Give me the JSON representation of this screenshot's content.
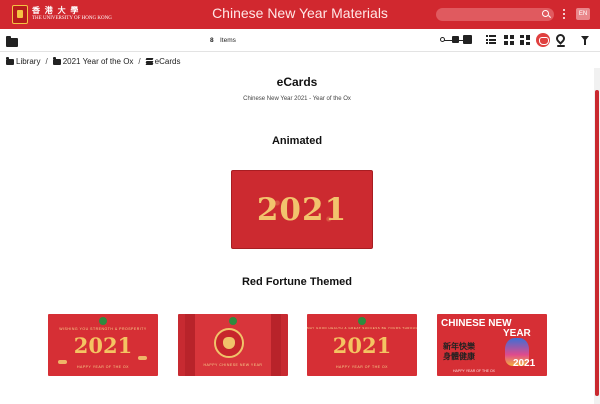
{
  "header": {
    "university_cn": "香 港 大 學",
    "university_en": "THE UNIVERSITY OF HONG KONG",
    "title": "Chinese New Year Materials",
    "search_placeholder": "",
    "language": "EN"
  },
  "toolbar": {
    "item_count": "8",
    "item_label": "Items"
  },
  "breadcrumb": [
    {
      "label": "Library",
      "icon": "folder-icon"
    },
    {
      "label": "2021 Year of the Ox",
      "icon": "folder-icon"
    },
    {
      "label": "eCards",
      "icon": "stack-icon"
    }
  ],
  "page": {
    "title": "eCards",
    "subtitle": "Chinese New Year 2021 - Year of the Ox"
  },
  "sections": [
    {
      "title": "Animated",
      "cards": [
        {
          "year": "2021"
        }
      ]
    },
    {
      "title": "Red Fortune Themed",
      "cards": [
        {
          "year": "2021",
          "top_text": "WISHING YOU STRENGTH & PROSPERITY",
          "bottom_text": "HAPPY YEAR OF THE OX"
        },
        {
          "bottom_text": "HAPPY CHINESE NEW YEAR"
        },
        {
          "year": "2021",
          "top_text": "MAY GOOD HEALTH & GREAT SUCCESS BE YOURS THROUGHOUT THE YEAR",
          "bottom_text": "HAPPY YEAR OF THE OX"
        },
        {
          "heading_1": "CHINESE NEW",
          "heading_2": "YEAR",
          "cn_line_1": "新年快樂",
          "cn_line_2": "身體健康",
          "year": "2021",
          "bottom_text": "HAPPY YEAR OF THE OX"
        }
      ]
    }
  ],
  "colors": {
    "header_bg": "#d1282f",
    "accent": "#d1282f",
    "gold": "#f2c46d"
  }
}
